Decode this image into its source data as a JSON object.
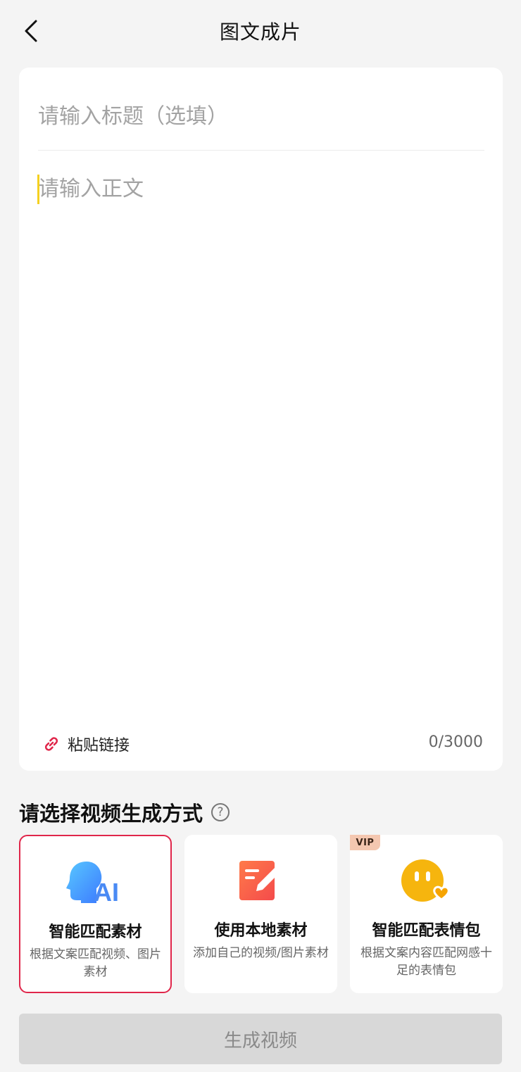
{
  "header": {
    "title": "图文成片"
  },
  "editor": {
    "title_placeholder": "请输入标题（选填）",
    "title_value": "",
    "body_placeholder": "请输入正文",
    "body_value": "",
    "paste_label": "粘贴链接",
    "char_count": "0/3000"
  },
  "mode_section": {
    "title": "请选择视频生成方式",
    "help_symbol": "?",
    "options": [
      {
        "title": "智能匹配素材",
        "desc": "根据文案匹配视频、图片素材",
        "icon": "ai-head-icon",
        "selected": true
      },
      {
        "title": "使用本地素材",
        "desc": "添加自己的视频/图片素材",
        "icon": "edit-note-icon",
        "selected": false
      },
      {
        "title": "智能匹配表情包",
        "desc": "根据文案内容匹配网感十足的表情包",
        "icon": "emoji-face-icon",
        "selected": false,
        "badge": "VIP"
      }
    ]
  },
  "footer": {
    "generate_label": "生成视频"
  },
  "colors": {
    "background": "#f4f4f4",
    "selected_border": "#e0264a",
    "caret": "#f5d020",
    "button_disabled_bg": "#d8d8d8",
    "button_disabled_text": "#8a8a8a"
  }
}
